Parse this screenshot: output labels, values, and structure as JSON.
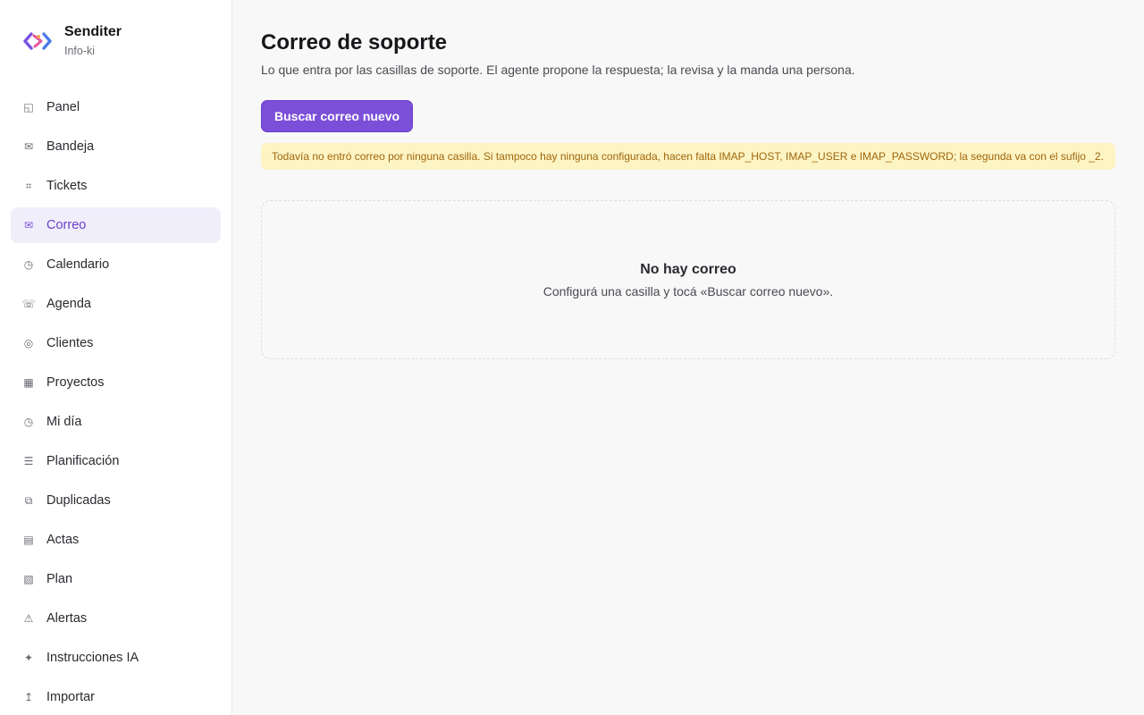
{
  "brand": {
    "name": "Senditer",
    "subtitle": "Info-ki",
    "accent_color": "#7b4fd8"
  },
  "sidebar": {
    "items": [
      {
        "label": "Panel",
        "icon": "panel-icon",
        "glyph": "◱",
        "active": false
      },
      {
        "label": "Bandeja",
        "icon": "inbox-icon",
        "glyph": "✉",
        "active": false
      },
      {
        "label": "Tickets",
        "icon": "tickets-icon",
        "glyph": "⌗",
        "active": false
      },
      {
        "label": "Correo",
        "icon": "mail-icon",
        "glyph": "✉",
        "active": true
      },
      {
        "label": "Calendario",
        "icon": "calendar-icon",
        "glyph": "◷",
        "active": false
      },
      {
        "label": "Agenda",
        "icon": "phone-icon",
        "glyph": "☏",
        "active": false
      },
      {
        "label": "Clientes",
        "icon": "clients-icon",
        "glyph": "◎",
        "active": false
      },
      {
        "label": "Proyectos",
        "icon": "projects-icon",
        "glyph": "▦",
        "active": false
      },
      {
        "label": "Mi día",
        "icon": "clock-icon",
        "glyph": "◷",
        "active": false
      },
      {
        "label": "Planificación",
        "icon": "list-icon",
        "glyph": "☰",
        "active": false
      },
      {
        "label": "Duplicadas",
        "icon": "duplicate-icon",
        "glyph": "⧉",
        "active": false
      },
      {
        "label": "Actas",
        "icon": "document-icon",
        "glyph": "▤",
        "active": false
      },
      {
        "label": "Plan",
        "icon": "plan-icon",
        "glyph": "▧",
        "active": false
      },
      {
        "label": "Alertas",
        "icon": "alert-icon",
        "glyph": "⚠",
        "active": false
      },
      {
        "label": "Instrucciones IA",
        "icon": "sparkle-icon",
        "glyph": "✦",
        "active": false
      },
      {
        "label": "Importar",
        "icon": "import-icon",
        "glyph": "↥",
        "active": false
      }
    ]
  },
  "main": {
    "title": "Correo de soporte",
    "subtitle": "Lo que entra por las casillas de soporte. El agente propone la respuesta; la revisa y la manda una persona.",
    "fetch_button": "Buscar correo nuevo",
    "alert": "Todavía no entró correo por ninguna casilla. Si tampoco hay ninguna configurada, hacen falta IMAP_HOST, IMAP_USER e IMAP_PASSWORD; la segunda va con el sufijo _2.",
    "empty_title": "No hay correo",
    "empty_subtitle": "Configurá una casilla y tocá «Buscar correo nuevo»."
  },
  "colors": {
    "active_nav_bg": "#f1eefc",
    "active_nav_text": "#6a3fc9",
    "alert_bg": "#fdf4c4",
    "alert_text": "#a1660c"
  }
}
